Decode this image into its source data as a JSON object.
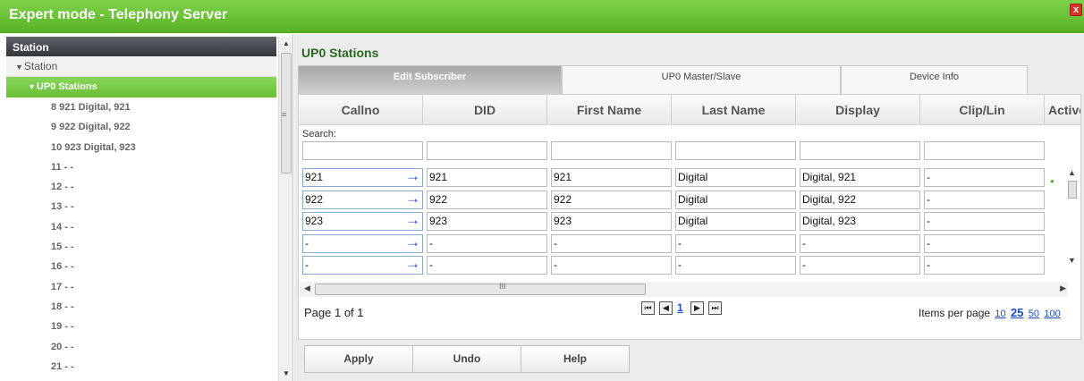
{
  "window": {
    "title": "Expert mode - Telephony Server",
    "close_glyph": "x"
  },
  "sidebar": {
    "header": "Station",
    "root": "Station",
    "active": "UP0 Stations",
    "items": [
      "8 921 Digital, 921",
      "9 922 Digital, 922",
      "10 923 Digital, 923",
      "11 - -",
      "12 - -",
      "13 - -",
      "14 - -",
      "15 - -",
      "16 - -",
      "17 - -",
      "18 - -",
      "19 - -",
      "20 - -",
      "21 - -"
    ]
  },
  "main": {
    "title": "UP0 Stations",
    "tabs": [
      "Edit Subscriber",
      "UP0 Master/Slave",
      "Device Info"
    ],
    "columns": [
      "Callno",
      "DID",
      "First Name",
      "Last Name",
      "Display",
      "Clip/Lin",
      "Active"
    ],
    "search_label": "Search:",
    "rows": [
      [
        "921",
        "921",
        "921",
        "Digital",
        "Digital, 921",
        "-"
      ],
      [
        "922",
        "922",
        "922",
        "Digital",
        "Digital, 922",
        "-"
      ],
      [
        "923",
        "923",
        "923",
        "Digital",
        "Digital, 923",
        "-"
      ],
      [
        "-",
        "-",
        "-",
        "-",
        "-",
        "-"
      ],
      [
        "-",
        "-",
        "-",
        "-",
        "-",
        "-"
      ]
    ],
    "pager": {
      "text": "Page 1 of 1",
      "current": "1",
      "items_per_page_label": "Items per page",
      "sizes": [
        "10",
        "25",
        "50",
        "100"
      ],
      "selected_size": "25"
    },
    "buttons": {
      "apply": "Apply",
      "undo": "Undo",
      "help": "Help"
    }
  },
  "colors": {
    "brand_green": "#69bf36",
    "link_blue": "#1a4ec6",
    "arrow_blue": "#1d4ed8"
  },
  "icons": [
    "close-icon",
    "triangle-down-icon",
    "arrow-right-icon",
    "first-page-icon",
    "prev-page-icon",
    "next-page-icon",
    "last-page-icon"
  ]
}
